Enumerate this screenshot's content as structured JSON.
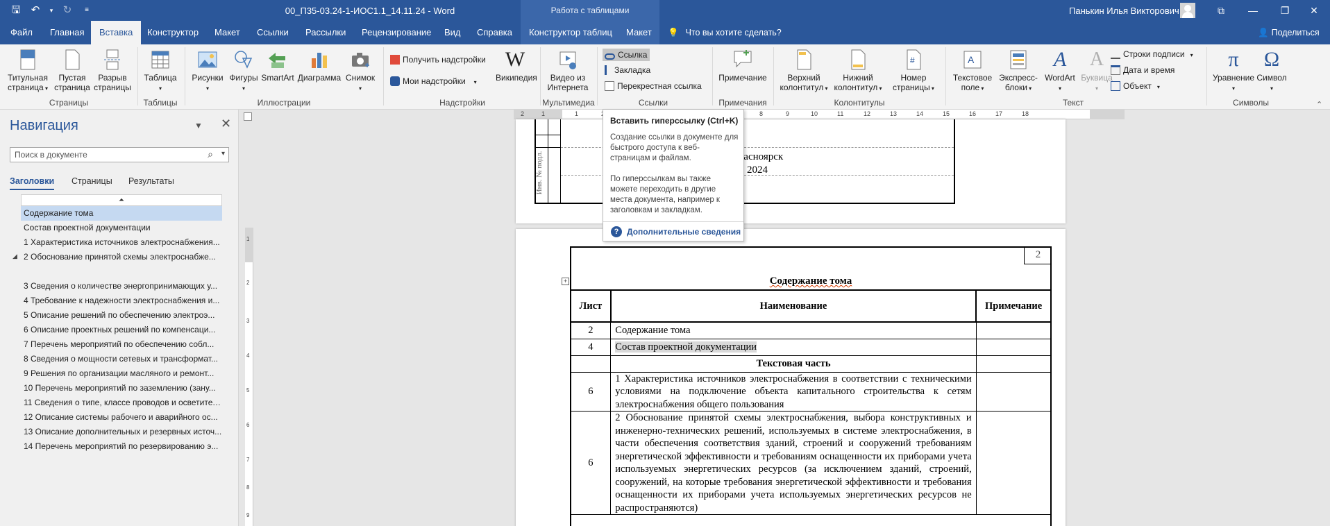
{
  "window": {
    "title": "00_П35-03.24-1-ИОС1.1_14.11.24 - Word",
    "context_group": "Работа с таблицами",
    "user": "Панькин Илья Викторович"
  },
  "tabs": {
    "items": [
      "Файл",
      "Главная",
      "Вставка",
      "Конструктор",
      "Макет",
      "Ссылки",
      "Рассылки",
      "Рецензирование",
      "Вид",
      "Справка",
      "Конструктор таблиц",
      "Макет"
    ],
    "tell_me": "Что вы хотите сделать?",
    "share": "Поделиться"
  },
  "ribbon": {
    "pages": {
      "cover": "Титульная\nстраница",
      "blank": "Пустая\nстраница",
      "break": "Разрыв\nстраницы",
      "label": "Страницы"
    },
    "tables": {
      "table": "Таблица",
      "label": "Таблицы"
    },
    "illustrations": {
      "pictures": "Рисунки",
      "shapes": "Фигуры",
      "smartart": "SmartArt",
      "chart": "Диаграмма",
      "screenshot": "Снимок",
      "label": "Иллюстрации"
    },
    "addins": {
      "get": "Получить надстройки",
      "my": "Мои надстройки",
      "wikipedia": "Википедия",
      "label": "Надстройки"
    },
    "media": {
      "online_video": "Видео из\nИнтернета",
      "label": "Мультимедиа"
    },
    "links": {
      "link": "Ссылка",
      "bookmark": "Закладка",
      "crossref": "Перекрестная ссылка",
      "label": "Ссылки"
    },
    "comments": {
      "comment": "Примечание",
      "label": "Примечания"
    },
    "headerfooter": {
      "header": "Верхний\nколонтитул",
      "footer": "Нижний\nколонтитул",
      "pagenum": "Номер\nстраницы",
      "label": "Колонтитулы"
    },
    "text": {
      "textbox": "Текстовое\nполе",
      "quickparts": "Экспресс-\nблоки",
      "wordart": "WordArt",
      "dropcap": "Буквица",
      "sigline": "Строки подписи",
      "datetime": "Дата и время",
      "object": "Объект",
      "label": "Текст"
    },
    "symbols": {
      "equation": "Уравнение",
      "symbol": "Символ",
      "label": "Символы"
    }
  },
  "nav": {
    "title": "Навигация",
    "search_placeholder": "Поиск в документе",
    "tabs": [
      "Заголовки",
      "Страницы",
      "Результаты"
    ],
    "items": [
      "Содержание тома",
      "Состав проектной документации",
      "1 Характеристика источников электроснабжения...",
      "2 Обоснование принятой схемы электроснабже...",
      "",
      "3 Сведения о количестве энергопринимающих у...",
      "4 Требование к надежности электроснабжения и...",
      "5 Описание решений по обеспечению электроэ...",
      "6 Описание проектных решений по компенсаци...",
      "7 Перечень мероприятий по обеспечению собл...",
      "8 Сведения о мощности сетевых и трансформат...",
      "9 Решения по организации масляного и ремонт...",
      "10 Перечень мероприятий по заземлению (зану...",
      "11 Сведения о типе, классе проводов и осветител...",
      "12 Описание системы рабочего и аварийного ос...",
      "13 Описание дополнительных и резервных источ...",
      "14 Перечень мероприятий по резервированию э..."
    ]
  },
  "ruler": {
    "h_numbers": [
      "2",
      "1",
      "1",
      "2",
      "3",
      "4",
      "5",
      "6",
      "7",
      "8",
      "9",
      "10",
      "11",
      "12",
      "13",
      "14",
      "15",
      "16",
      "17",
      "18"
    ],
    "v_numbers": [
      "1",
      "2",
      "3",
      "4",
      "5",
      "6",
      "7",
      "8",
      "9"
    ]
  },
  "page1": {
    "stamp_label": "Инв. № подл.",
    "city": "Красноярск",
    "year": "2024"
  },
  "page2": {
    "page_number": "2",
    "heading": "Содержание тома",
    "table": {
      "headers": [
        "Лист",
        "Наименование",
        "Примечание"
      ],
      "rows": [
        {
          "sheet": "2",
          "name": "Содержание тома",
          "note": ""
        },
        {
          "sheet": "4",
          "name": "Состав проектной документации",
          "note": ""
        },
        {
          "section": "Текстовая часть"
        },
        {
          "sheet": "6",
          "name": "1 Характеристика источников электроснабжения в соответствии с техническими условиями на подключение объекта капитального строительства к сетям электроснабжения общего пользования",
          "note": ""
        },
        {
          "sheet": "6",
          "name": "2 Обоснование принятой схемы электроснабжения, выбора конструктивных и инженерно-технических решений, используемых в системе электроснабжения, в части обеспечения соответствия зданий, строений и сооружений требованиям энергетической эффективности и требованиям оснащенности их приборами учета используемых энергетических ресурсов (за исключением зданий, строений, сооружений, на которые требования энергетической эффективности и требования оснащенности их приборами учета используемых энергетических ресурсов не распространяются)",
          "note": ""
        }
      ]
    }
  },
  "tooltip": {
    "title": "Вставить гиперссылку (Ctrl+K)",
    "p1": "Создание ссылки в документе для быстрого доступа к веб-страницам и файлам.",
    "p2": "По гиперссылкам вы также можете переходить в другие места документа, например к заголовкам и закладкам.",
    "more": "Дополнительные сведения"
  },
  "colors": {
    "word_blue": "#2b579a",
    "context_band": "#3b67aa",
    "ribbon_bg": "#f3f3f3",
    "selection": "#c5d9f1"
  }
}
